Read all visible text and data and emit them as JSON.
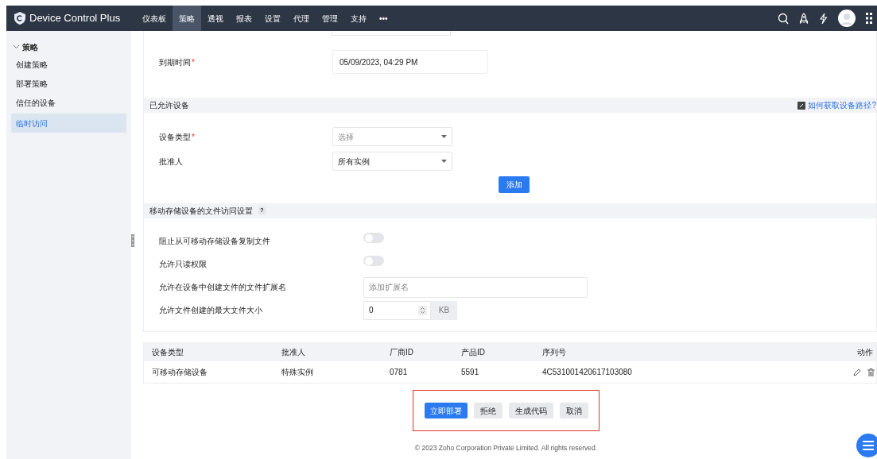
{
  "header": {
    "product": "Device Control Plus",
    "nav": [
      {
        "label": "仪表板",
        "selected": false
      },
      {
        "label": "策略",
        "selected": true
      },
      {
        "label": "透视",
        "selected": false
      },
      {
        "label": "报表",
        "selected": false
      },
      {
        "label": "设置",
        "selected": false
      },
      {
        "label": "代理",
        "selected": false
      },
      {
        "label": "管理",
        "selected": false
      },
      {
        "label": "支持",
        "selected": false
      }
    ],
    "more": "•••"
  },
  "sidebar": {
    "group": {
      "label": "策略",
      "expanded": true,
      "children": [
        {
          "label": "创建策略",
          "selected": false
        },
        {
          "label": "部署策略",
          "selected": false
        },
        {
          "label": "信任的设备",
          "selected": false
        },
        {
          "label": "临时访问",
          "selected": true
        }
      ]
    }
  },
  "expiry": {
    "label": "到期时间",
    "required_mark": "*",
    "value": "05/09/2023, 04:29 PM"
  },
  "allowed_devices": {
    "title": "已允许设备",
    "help_link": "如何获取设备路径?",
    "fields": [
      {
        "label": "设备类型",
        "required_mark": "*",
        "placeholder": "选择"
      },
      {
        "label": "批准人",
        "value": "所有实例"
      }
    ],
    "add_button": "添加"
  },
  "file_access": {
    "title": "移动存储设备的文件访问设置",
    "help": "?",
    "settings": [
      {
        "kind": "toggle",
        "label": "阻止从可移动存储设备复制文件",
        "on": false
      },
      {
        "kind": "toggle",
        "label": "允许只读权限",
        "on": false
      },
      {
        "kind": "text",
        "label": "允许在设备中创建文件的文件扩展名",
        "placeholder": "添加扩展名"
      },
      {
        "kind": "number",
        "label": "允许文件创建的最大文件大小",
        "value": "0",
        "unit": "KB"
      }
    ]
  },
  "table": {
    "columns": [
      "设备类型",
      "批准人",
      "厂商ID",
      "产品ID",
      "序列号",
      "动作"
    ],
    "rows": [
      [
        "可移动存储设备",
        "特殊实例",
        "0781",
        "5591",
        "4C531001420617103080"
      ]
    ]
  },
  "actions": [
    {
      "label": "立即部署",
      "primary": true
    },
    {
      "label": "拒绝",
      "primary": false
    },
    {
      "label": "生成代码",
      "primary": false
    },
    {
      "label": "取消",
      "primary": false
    }
  ],
  "footer": "© 2023 Zoho Corporation Private Limited. All rights reserved."
}
